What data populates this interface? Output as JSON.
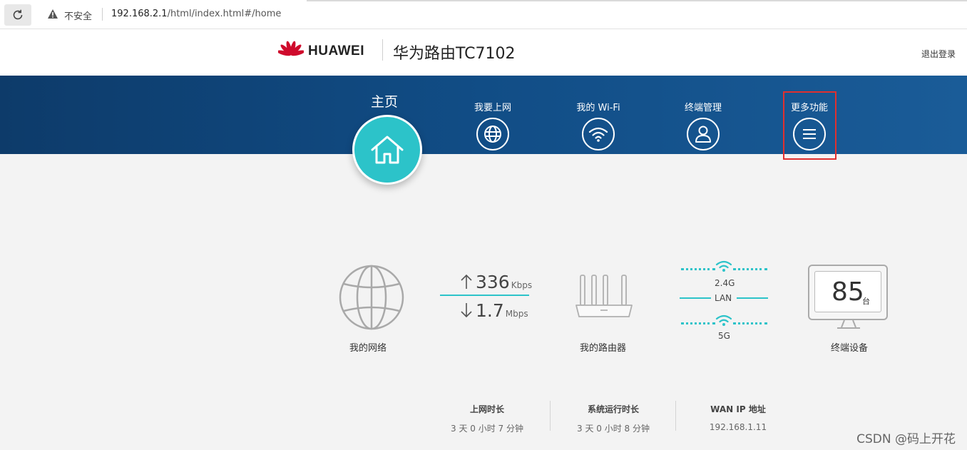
{
  "browser": {
    "insecure_label": "不安全",
    "url_host": "192.168.2.1",
    "url_path": "/html/index.html#/home"
  },
  "header": {
    "brand": "HUAWEI",
    "product": "华为路由TC7102",
    "logout": "退出登录"
  },
  "nav": {
    "home": "主页",
    "items": [
      {
        "label": "我要上网",
        "icon": "globe-icon"
      },
      {
        "label": "我的 Wi-Fi",
        "icon": "wifi-icon"
      },
      {
        "label": "终端管理",
        "icon": "user-icon"
      },
      {
        "label": "更多功能",
        "icon": "menu-icon"
      }
    ]
  },
  "dashboard": {
    "network_label": "我的网络",
    "upload_value": "336",
    "upload_unit": "Kbps",
    "download_value": "1.7",
    "download_unit": "Mbps",
    "router_label": "我的路由器",
    "band_24": "2.4G",
    "lan": "LAN",
    "band_5": "5G",
    "device_count": "85",
    "device_unit": "台",
    "devices_label": "终端设备"
  },
  "info": {
    "online_title": "上网时长",
    "online_value": "3 天 0 小时 7 分钟",
    "uptime_title": "系统运行时长",
    "uptime_value": "3 天 0 小时 8 分钟",
    "wan_title": "WAN IP 地址",
    "wan_value": "192.168.1.11"
  },
  "watermark": "CSDN @码上开花",
  "colors": {
    "accent": "#2cc3c9",
    "nav_band": "#114d86",
    "highlight": "#e0302f",
    "brand_red": "#cf0a2c"
  }
}
